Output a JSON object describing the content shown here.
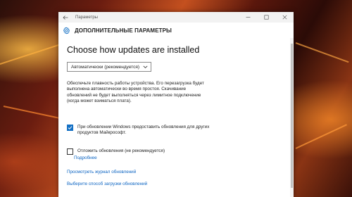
{
  "window": {
    "title": "Параметры",
    "back_icon": "back-arrow-icon",
    "controls": [
      "minimize-icon",
      "maximize-icon",
      "close-icon"
    ]
  },
  "header": {
    "icon": "gear-icon",
    "title": "ДОПОЛНИТЕЛЬНЫЕ ПАРАМЕТРЫ",
    "accent_color": "#1470c4"
  },
  "main": {
    "page_title": "Choose how updates are installed",
    "install_mode": {
      "selected": "Автоматически (рекомендуется)"
    },
    "description": "Обеспечьте плавность работы устройства. Его перезагрузка будет выполнена автоматически во время простоя. Скачивание обновлений не будет выполняться через лимитное подключение (когда может взиматься плата).",
    "microsoft_updates": {
      "checked": true,
      "label": "При обновлении Windows предоставить обновления для других продуктов Майкрософт."
    },
    "defer_updates": {
      "checked": false,
      "label": "Отложить обновления (не рекомендуется)",
      "more_link": "Подробнее"
    },
    "links": {
      "history": "Просмотреть журнал обновлений",
      "delivery": "Выберите способ загрузки обновлений"
    },
    "link_color": "#0a63c2"
  }
}
